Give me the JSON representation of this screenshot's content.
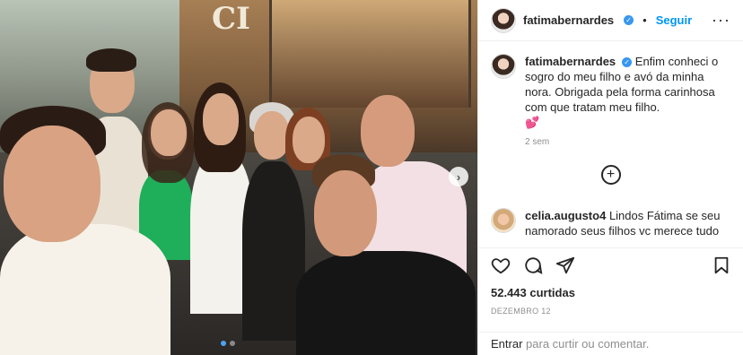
{
  "post": {
    "username": "fatimabernardes",
    "follow_label": "Seguir",
    "separator": "•",
    "more_label": "···",
    "sign_text": "CI",
    "caption": {
      "username": "fatimabernardes",
      "text": "Enfim conheci o sogro do meu filho e avó da minha nora. Obrigada pela forma carinhosa com que tratam meu filho.",
      "emoji": "💕",
      "time": "2 sem"
    },
    "comments": [
      {
        "username": "celia.augusto4",
        "text": "Lindos Fátima se seu namorado seus filhos vc merece tudo"
      }
    ],
    "likes": "52.443 curtidas",
    "date": "DEZEMBRO 12",
    "add_comment": {
      "enter_label": "Entrar",
      "rest_label": "para curtir ou comentar."
    },
    "carousel": {
      "total": 2,
      "active_index": 0
    }
  },
  "colors": {
    "accent": "#0095f6",
    "verified": "#3897f0",
    "text": "#262626",
    "muted": "#8e8e8e"
  },
  "icons": [
    "verified-icon",
    "more-icon",
    "chevron-right-icon",
    "plus-circle-icon",
    "heart-icon",
    "comment-icon",
    "share-icon",
    "bookmark-icon"
  ]
}
